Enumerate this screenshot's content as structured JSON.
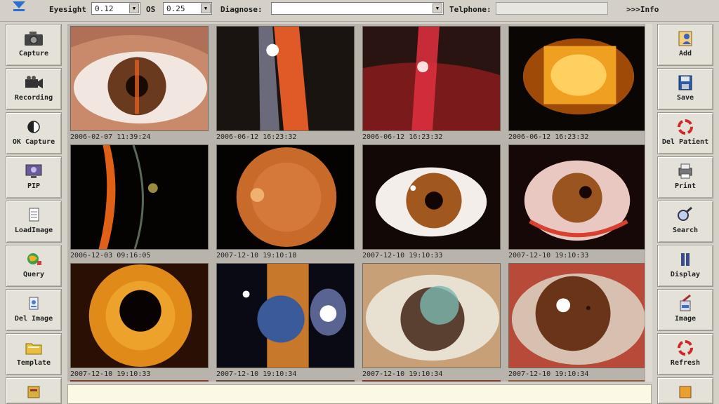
{
  "toolbar": {
    "eyesight_label": "Eyesight",
    "od_value": "0.12",
    "os_label": "OS",
    "os_value": "0.25",
    "diagnose_label": "Diagnose:",
    "diagnose_value": "",
    "telphone_label": "Telphone:",
    "telphone_value": "",
    "info_label": ">>>Info"
  },
  "left_buttons": [
    {
      "label": "Capture",
      "icon": "camera-icon"
    },
    {
      "label": "Recording",
      "icon": "video-camera-icon"
    },
    {
      "label": "OK Capture",
      "icon": "half-circle-icon"
    },
    {
      "label": "PIP",
      "icon": "monitor-icon"
    },
    {
      "label": "LoadImage",
      "icon": "document-icon"
    },
    {
      "label": "Query",
      "icon": "globe-icon"
    },
    {
      "label": "Del Image",
      "icon": "delete-image-icon"
    },
    {
      "label": "Template",
      "icon": "folder-icon"
    }
  ],
  "right_buttons": [
    {
      "label": "Add",
      "icon": "add-patient-icon"
    },
    {
      "label": "Save",
      "icon": "floppy-disk-icon"
    },
    {
      "label": "Del Patient",
      "icon": "recycle-icon"
    },
    {
      "label": "Print",
      "icon": "printer-icon"
    },
    {
      "label": "Search",
      "icon": "magnifier-icon"
    },
    {
      "label": "Display",
      "icon": "display-icon"
    },
    {
      "label": "Image",
      "icon": "paint-image-icon"
    },
    {
      "label": "Refresh",
      "icon": "refresh-icon"
    }
  ],
  "images": [
    {
      "timestamp": "2006-02-07 11:39:24"
    },
    {
      "timestamp": "2006-06-12 16:23:32"
    },
    {
      "timestamp": "2006-06-12 16:23:32"
    },
    {
      "timestamp": "2006-06-12 16:23:32"
    },
    {
      "timestamp": "2006-12-03 09:16:05"
    },
    {
      "timestamp": "2007-12-10 19:10:18"
    },
    {
      "timestamp": "2007-12-10 19:10:33"
    },
    {
      "timestamp": "2007-12-10 19:10:33"
    },
    {
      "timestamp": "2007-12-10 19:10:33"
    },
    {
      "timestamp": "2007-12-10 19:10:34"
    },
    {
      "timestamp": "2007-12-10 19:10:34"
    },
    {
      "timestamp": "2007-12-10 19:10:34"
    }
  ],
  "colors": {
    "window_bg": "#d4d0c8",
    "gallery_bg": "#b8b4ac",
    "notes_bg": "#fbf8e3"
  }
}
